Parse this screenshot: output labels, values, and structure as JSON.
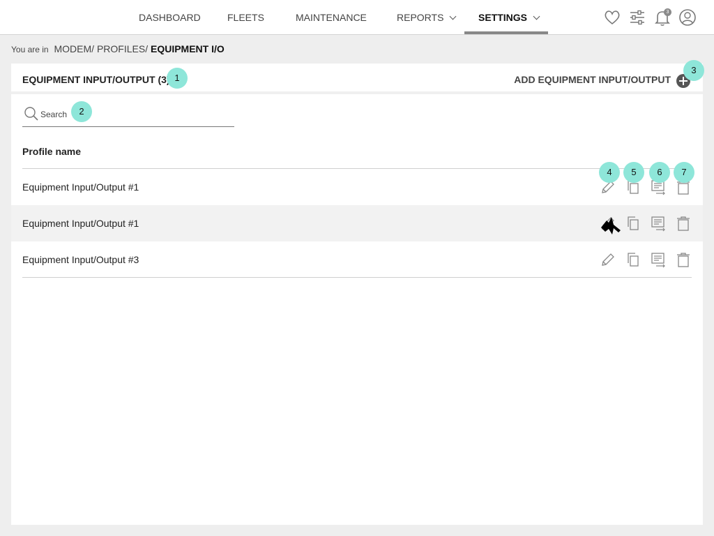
{
  "nav": {
    "items": [
      {
        "label": "DASHBOARD"
      },
      {
        "label": "FLEETS"
      },
      {
        "label": "MAINTENANCE"
      },
      {
        "label": "REPORTS"
      },
      {
        "label": "SETTINGS"
      }
    ],
    "active": "SETTINGS",
    "notification_count": "3",
    "icons": [
      "heart-icon",
      "sliders-icon",
      "bell-icon",
      "user-icon"
    ]
  },
  "breadcrumb": {
    "prefix": "You are in",
    "items": [
      "MODEM/",
      "PROFILES/"
    ],
    "current": "EQUIPMENT I/O"
  },
  "card": {
    "title": "EQUIPMENT INPUT/OUTPUT (3)",
    "add_label": "ADD EQUIPMENT INPUT/OUTPUT"
  },
  "search": {
    "placeholder": "Search"
  },
  "table": {
    "column_header": "Profile name",
    "rows": [
      {
        "name": "Equipment Input/Output #1"
      },
      {
        "name": "Equipment Input/Output #1"
      },
      {
        "name": "Equipment Input/Output #3"
      }
    ],
    "row_actions": [
      "edit-icon",
      "copy-icon",
      "list-icon",
      "delete-icon"
    ]
  },
  "callouts": [
    "1",
    "2",
    "3",
    "4",
    "5",
    "6",
    "7"
  ],
  "colors": {
    "callout": "#8ee6d9",
    "row_highlight": "#f2f2f2",
    "icon_gray": "#888888"
  }
}
